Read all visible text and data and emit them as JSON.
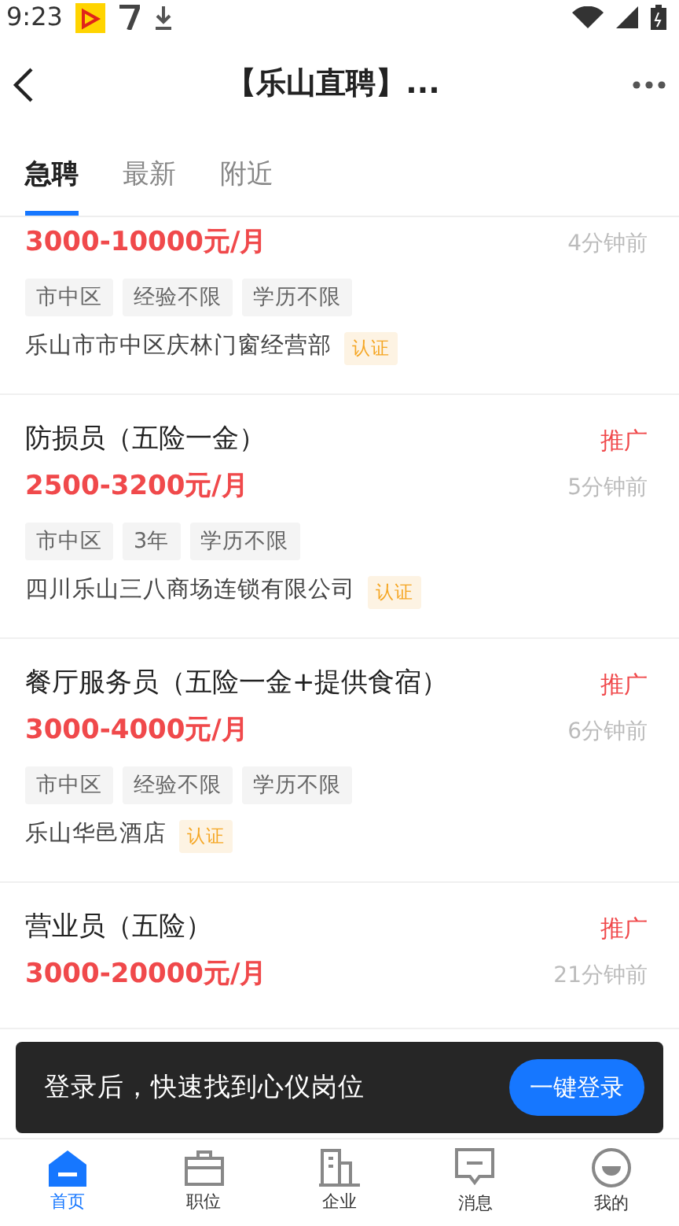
{
  "status_bar": {
    "time": "9:23"
  },
  "header": {
    "title": "【乐山直聘】..."
  },
  "tabs": [
    {
      "label": "急聘",
      "selected": true
    },
    {
      "label": "最新",
      "selected": false
    },
    {
      "label": "附近",
      "selected": false
    }
  ],
  "jobs": [
    {
      "salary": "3000-10000元/月",
      "posted": "4分钟前",
      "tags": [
        "市中区",
        "经验不限",
        "学历不限"
      ],
      "company": "乐山市市中区庆林门窗经营部",
      "badge": "认证"
    },
    {
      "title": "防损员（五险一金）",
      "promo": "推广",
      "salary": "2500-3200元/月",
      "posted": "5分钟前",
      "tags": [
        "市中区",
        "3年",
        "学历不限"
      ],
      "company": "四川乐山三八商场连锁有限公司",
      "badge": "认证"
    },
    {
      "title": "餐厅服务员（五险一金+提供食宿）",
      "promo": "推广",
      "salary": "3000-4000元/月",
      "posted": "6分钟前",
      "tags": [
        "市中区",
        "经验不限",
        "学历不限"
      ],
      "company": "乐山华邑酒店",
      "badge": "认证"
    },
    {
      "title": "营业员（五险）",
      "promo": "推广",
      "salary": "3000-20000元/月",
      "posted": "21分钟前"
    }
  ],
  "login_banner": {
    "text": "登录后，快速找到心仪岗位",
    "button": "一键登录"
  },
  "bottom_nav": [
    {
      "label": "首页",
      "selected": true
    },
    {
      "label": "职位",
      "selected": false
    },
    {
      "label": "企业",
      "selected": false
    },
    {
      "label": "消息",
      "selected": false
    },
    {
      "label": "我的",
      "selected": false
    }
  ]
}
